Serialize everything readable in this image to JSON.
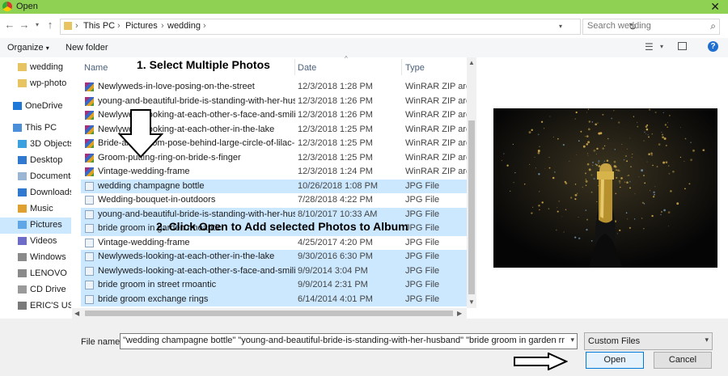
{
  "window": {
    "title": "Open"
  },
  "breadcrumb": [
    "This PC",
    "Pictures",
    "wedding"
  ],
  "search": {
    "placeholder": "Search wedding"
  },
  "toolbar": {
    "organize": "Organize",
    "new_folder": "New folder"
  },
  "nav": [
    {
      "label": "wedding",
      "icon": "folder-icon",
      "indent": 22
    },
    {
      "label": "wp-photo",
      "icon": "folder-icon",
      "indent": 22
    },
    {
      "label": "OneDrive",
      "icon": "cloud-icon",
      "indent": 16
    },
    {
      "label": "This PC",
      "icon": "pc-icon",
      "indent": 16
    },
    {
      "label": "3D Objects",
      "icon": "cube-icon",
      "indent": 22
    },
    {
      "label": "Desktop",
      "icon": "desktop-icon",
      "indent": 22
    },
    {
      "label": "Documents",
      "icon": "documents-icon",
      "indent": 22
    },
    {
      "label": "Downloads",
      "icon": "downloads-icon",
      "indent": 22
    },
    {
      "label": "Music",
      "icon": "music-icon",
      "indent": 22
    },
    {
      "label": "Pictures",
      "icon": "pictures-icon",
      "indent": 22,
      "selected": true
    },
    {
      "label": "Videos",
      "icon": "videos-icon",
      "indent": 22
    },
    {
      "label": "Windows",
      "icon": "drive-icon",
      "indent": 22
    },
    {
      "label": "LENOVO",
      "icon": "drive-icon",
      "indent": 22
    },
    {
      "label": "CD Drive",
      "icon": "cd-icon",
      "indent": 22
    },
    {
      "label": "ERIC'S USB",
      "icon": "usb-icon",
      "indent": 22
    }
  ],
  "columns": {
    "name": "Name",
    "date": "Date",
    "type": "Type"
  },
  "files": [
    {
      "name": "Newlyweds-in-love-posing-on-the-street",
      "date": "12/3/2018 1:28 PM",
      "type": "WinRAR ZIP archive",
      "kind": "zip",
      "selected": false
    },
    {
      "name": "young-and-beautiful-bride-is-standing-with-her-husband",
      "date": "12/3/2018 1:26 PM",
      "type": "WinRAR ZIP archive",
      "kind": "zip",
      "selected": false
    },
    {
      "name": "Newlyweds-looking-at-each-other-s-face-and-smiling",
      "date": "12/3/2018 1:26 PM",
      "type": "WinRAR ZIP archive",
      "kind": "zip",
      "selected": false
    },
    {
      "name": "Newlyweds-looking-at-each-other-in-the-lake",
      "date": "12/3/2018 1:25 PM",
      "type": "WinRAR ZIP archive",
      "kind": "zip",
      "selected": false
    },
    {
      "name": "Bride-and-groom-pose-behind-large-circle-of-lilac-in-garden",
      "date": "12/3/2018 1:25 PM",
      "type": "WinRAR ZIP archive",
      "kind": "zip",
      "selected": false
    },
    {
      "name": "Groom-putting-ring-on-bride-s-finger",
      "date": "12/3/2018 1:25 PM",
      "type": "WinRAR ZIP archive",
      "kind": "zip",
      "selected": false
    },
    {
      "name": "Vintage-wedding-frame",
      "date": "12/3/2018 1:24 PM",
      "type": "WinRAR ZIP archive",
      "kind": "zip",
      "selected": false
    },
    {
      "name": "wedding champagne bottle",
      "date": "10/26/2018 1:08 PM",
      "type": "JPG File",
      "kind": "jpg",
      "selected": true
    },
    {
      "name": "Wedding-bouquet-in-outdoors",
      "date": "7/28/2018 4:22 PM",
      "type": "JPG File",
      "kind": "jpg",
      "selected": false
    },
    {
      "name": "young-and-beautiful-bride-is-standing-with-her-husband",
      "date": "8/10/2017 10:33 AM",
      "type": "JPG File",
      "kind": "jpg",
      "selected": true
    },
    {
      "name": "bride groom in garden rmoantic",
      "date": "",
      "type": "JPG File",
      "kind": "jpg",
      "selected": true
    },
    {
      "name": "Vintage-wedding-frame",
      "date": "4/25/2017 4:20 PM",
      "type": "JPG File",
      "kind": "jpg",
      "selected": false
    },
    {
      "name": "Newlyweds-looking-at-each-other-in-the-lake",
      "date": "9/30/2016 6:30 PM",
      "type": "JPG File",
      "kind": "jpg",
      "selected": true
    },
    {
      "name": "Newlyweds-looking-at-each-other-s-face-and-smiling",
      "date": "9/9/2014 3:04 PM",
      "type": "JPG File",
      "kind": "jpg",
      "selected": true
    },
    {
      "name": "bride groom in street rmoantic",
      "date": "9/9/2014 2:31 PM",
      "type": "JPG File",
      "kind": "jpg",
      "selected": true
    },
    {
      "name": "bride groom exchange rings",
      "date": "6/14/2014 4:01 PM",
      "type": "JPG File",
      "kind": "jpg",
      "selected": true
    }
  ],
  "annotations": {
    "step1": "1. Select Multiple Photos",
    "step2": "2. Click Open to Add selected Photos to Album"
  },
  "footer": {
    "file_name_label": "File name:",
    "file_name_value": "\"wedding champagne bottle\" \"young-and-beautiful-bride-is-standing-with-her-husband\" \"bride groom in garden rmoantic\" \"",
    "filter_value": "Custom Files",
    "open_label": "Open",
    "cancel_label": "Cancel"
  },
  "colors": {
    "titlebar": "#8fd152",
    "selection": "#cce8ff",
    "accent": "#0078d7"
  }
}
